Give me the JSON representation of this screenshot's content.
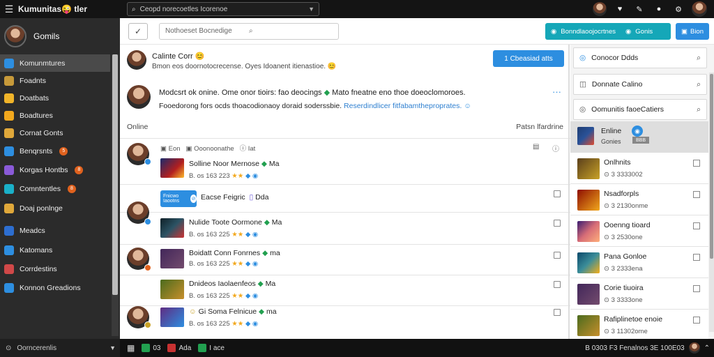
{
  "titlebar": {
    "menu_icon": "hamburger-icon",
    "app_name": "Kumunitas",
    "app_suffix": "tler",
    "search_text": "Ceopd norecoetles Icorenoe",
    "icons": [
      "bell-icon",
      "tag-icon",
      "pin-icon",
      "gear-icon"
    ]
  },
  "sidebar": {
    "profile_name": "Gomils",
    "items": [
      {
        "label": "Komunmtures",
        "color": "#2d8ee0",
        "active": true,
        "badge": ""
      },
      {
        "label": "Foadnts",
        "color": "#c79a3a",
        "active": false,
        "badge": ""
      },
      {
        "label": "Doatbats",
        "color": "#f0b429",
        "active": false,
        "badge": ""
      },
      {
        "label": "Boadtures",
        "color": "#f2a81d",
        "active": false,
        "badge": ""
      },
      {
        "label": "Cornat Gonts",
        "color": "#e0a83a",
        "active": false,
        "badge": ""
      },
      {
        "label": "Benqrsnts",
        "color": "#2d8ee0",
        "active": false,
        "badge": "5"
      },
      {
        "label": "Korgas Hontbs",
        "color": "#8a5ad8",
        "active": false,
        "badge": "8"
      },
      {
        "label": "Comntentles",
        "color": "#1ab0c8",
        "active": false,
        "badge": "8"
      },
      {
        "label": "Doaj ponlnge",
        "color": "#e0a83a",
        "active": false,
        "badge": ""
      },
      {
        "label": "Meadcs",
        "color": "#2d6ed0",
        "active": false,
        "badge": ""
      },
      {
        "label": "Katomans",
        "color": "#2d8ee0",
        "active": false,
        "badge": ""
      },
      {
        "label": "Corrdestins",
        "color": "#d04848",
        "active": false,
        "badge": ""
      },
      {
        "label": "Konnon Greadions",
        "color": "#2d8ee0",
        "active": false,
        "badge": ""
      }
    ],
    "footer_label": "Oorncerenlis"
  },
  "toolbar": {
    "filter_placeholder": "Nothoeset Bocnedige",
    "teal_button_label": "Bonndlaoojocrtnes",
    "teal_button_label2": "Gonis",
    "blue_button_label": "Bion"
  },
  "post": {
    "title": "Calinte Corr",
    "subtitle": "Bmon eos doornotocrecense. Oyes Idoanent itienastioe.",
    "button_label": "1 Cbeasiad atts"
  },
  "post2": {
    "line1": "Modcsrt ok onine. Ome onor tioirs: fao deocings",
    "line1b": "Mato fneatne eno thoe doeoclomoroes.",
    "line2": "Fooedorong fors ocds thoacodionaoy doraid soderssbie.",
    "line2_link": "Reserdindlicer fitfabamtheproprates."
  },
  "section": {
    "left": "Online",
    "right": "Patsn lfardrine"
  },
  "feed": {
    "top_meta": {
      "a": "Eon",
      "b": "Ooonoonathe",
      "c": "Iat"
    },
    "rows": [
      {
        "title": "Solline Noor Mernose",
        "tail": "Ma",
        "meta": "B. os 163 223"
      },
      {
        "title": "Eacse Feigric",
        "tail": "Dda",
        "meta": ""
      },
      {
        "title": "Nulide Toote Oormone",
        "tail": "Ma",
        "meta": "B. os 163 225"
      },
      {
        "title": "Boidatt Conn Fonrnes",
        "tail": "ma",
        "meta": "B. os 163 225"
      },
      {
        "title": "Dnideos Iaolaenfeos",
        "tail": "Ma",
        "meta": "B. os 163 225"
      },
      {
        "title": "Gi Soma Felnicue",
        "tail": "ma",
        "meta": "B. os 163 225"
      }
    ],
    "banner_label": "Fnicwo Iaootns"
  },
  "rightpanel": {
    "searches": [
      "Conocor Ddds",
      "Donnate Calino",
      "Oomunitis faoeCatiers"
    ],
    "selected": {
      "title": "Enline",
      "sub": "Gonies",
      "tag": "BBB"
    },
    "items": [
      {
        "title": "Onlhnits",
        "sub": "3 3333002"
      },
      {
        "title": "Nsadforpls",
        "sub": "3 2130onme"
      },
      {
        "title": "Ooenng tioard",
        "sub": "3 2530one"
      },
      {
        "title": "Pana Gonloe",
        "sub": "3 2333ena"
      },
      {
        "title": "Corie tiuoira",
        "sub": "3 3333one"
      },
      {
        "title": "Rafiplinetoe enoie",
        "sub": "3 11302ome"
      }
    ]
  },
  "taskbar": {
    "items": [
      "03",
      "Ada",
      "I ace"
    ],
    "clock": "B 0303 F3 Fenalnos 3E 100E03"
  },
  "colors": {
    "accent_blue": "#2d8ee0",
    "teal": "#15a7b8",
    "sidebar_bg": "#2b2b2b"
  }
}
